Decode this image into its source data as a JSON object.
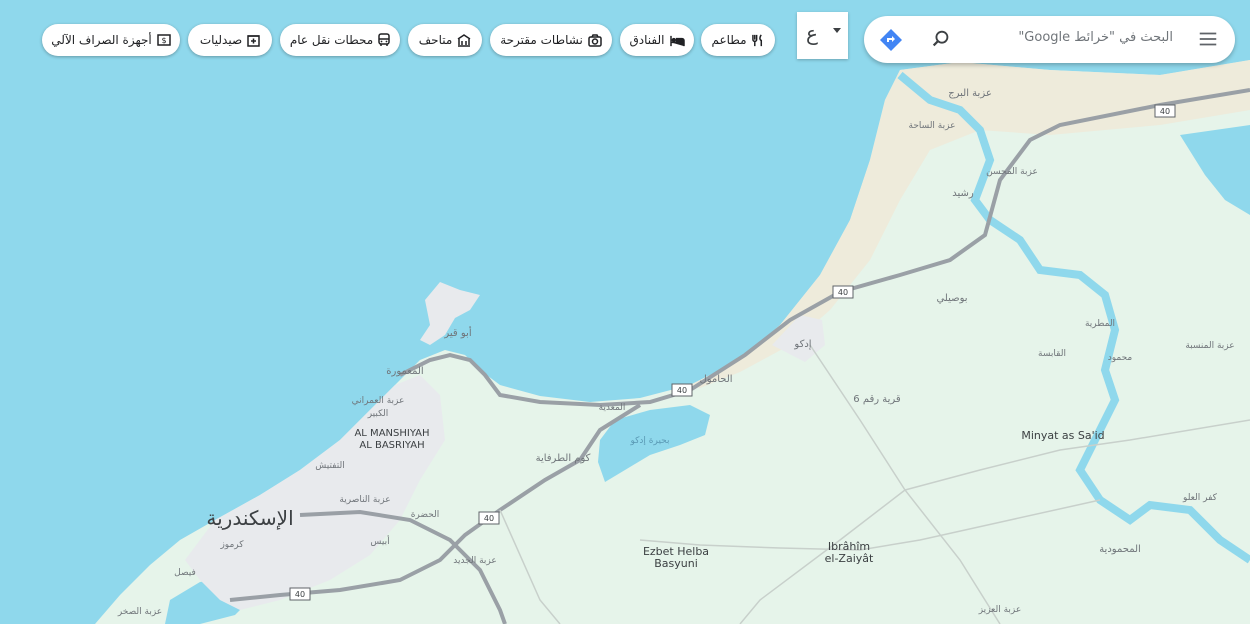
{
  "search": {
    "placeholder": "البحث في \"خرائط Google\"",
    "keyboard_char": "ع"
  },
  "chips": [
    {
      "label": "مطاعم",
      "icon": "fork-knife-icon"
    },
    {
      "label": "الفنادق",
      "icon": "bed-icon"
    },
    {
      "label": "نشاطات مقترحة",
      "icon": "camera-icon"
    },
    {
      "label": "متاحف",
      "icon": "museum-icon"
    },
    {
      "label": "محطات نقل عام",
      "icon": "bus-icon"
    },
    {
      "label": "صيدليات",
      "icon": "pharmacy-icon"
    },
    {
      "label": "أجهزة الصراف الآلي",
      "icon": "atm-icon"
    }
  ],
  "map": {
    "colors": {
      "water": "#8fd8ec",
      "land": "#e6f4ea",
      "sand": "#eee9d8",
      "road": "#9aa0a6",
      "urban": "#e8eaed"
    },
    "labels": {
      "alexandria": "الإسكندرية",
      "manshiyah_1": "AL MANSHIYAH",
      "manshiyah_2": "AL BASRIYAH",
      "minyat": "Minyat as Sa'id",
      "ezbet_1": "Ezbet Helba",
      "ezbet_2": "Basyuni",
      "ibrahim_1": "Ibrâhîm",
      "ibrahim_2": "el-Zaiyât",
      "abu_qir": "أبو قير",
      "maamoura": "المعمورة",
      "kom": "كوم الطرفاية",
      "qarya6": "قرية رقم 6",
      "edko": "إدكو",
      "busili": "بوصيلي",
      "hamad": "الحامول",
      "mahmoudia": "المحمودية",
      "ezbet_borg": "عزبة البرج",
      "rashid": "رشيد",
      "karmous": "كرموز",
      "bahr": "بحيرة إدكو",
      "hadra": "الحضرة",
      "ezbet_jadid": "عزبة الجديد",
      "kafr": "كفر العلو",
      "ezbet_aziz": "عزبة العزيز",
      "faisal": "فيصل",
      "tariq": "التفتيش",
      "ezbet_1b": "عزبة العمراني",
      "ezbet_1c": "الكبير",
      "gaz": "المعدية",
      "ezbet_mm": "عزبة المحسن",
      "ezbet_sat": "عزبة الساحة",
      "beesh": "أبيس",
      "ezbet_nasr": "عزبة الناصرية",
      "sakhr": "عزبة الصخر",
      "mahmoud": "محمود",
      "qaba": "القابسة",
      "mansaba": "عزبة المنسبة",
      "matras": "المطرية",
      "roads": {
        "r40": "40"
      }
    }
  }
}
